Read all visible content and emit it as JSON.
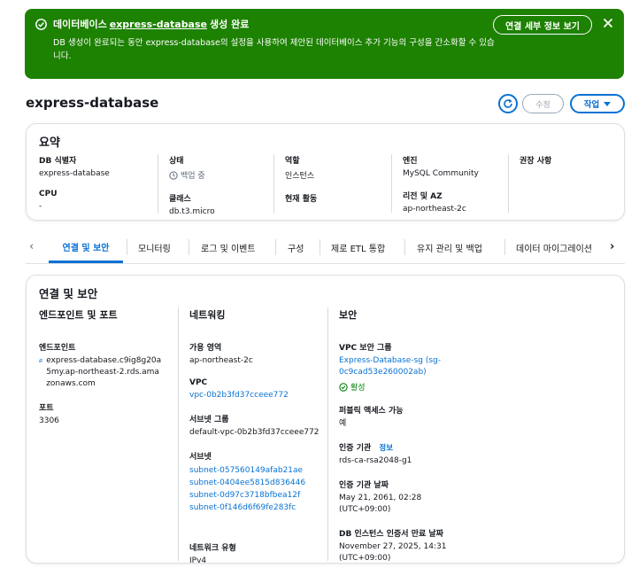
{
  "flash": {
    "title_prefix": "데이터베이스",
    "db_name": "express-database",
    "title_suffix": "생성 완료",
    "message": "DB 생성이 완료되는 동안 express-database의 설정을 사용하여 제안된 데이터베이스 추가 기능의 구성을 간소화할 수 있습니다.",
    "detail_button": "연결 세부 정보 보기",
    "color": "#1d8102"
  },
  "header": {
    "title": "express-database",
    "edit_button": "수정",
    "action_button": "작업"
  },
  "summary": {
    "title": "요약",
    "fields": {
      "db_id_label": "DB 식별자",
      "db_id_value": "express-database",
      "cpu_label": "CPU",
      "cpu_value": "-",
      "status_label": "상태",
      "status_value": "백업 중",
      "class_label": "클래스",
      "class_value": "db.t3.micro",
      "role_label": "역할",
      "role_value": "인스턴스",
      "activity_label": "현재 활동",
      "engine_label": "엔진",
      "engine_value": "MySQL Community",
      "region_label": "리전 및 AZ",
      "region_value": "ap-northeast-2c",
      "recommend_label": "권장 사항"
    }
  },
  "tabs": [
    {
      "label": "연결 및 보안"
    },
    {
      "label": "모니터링"
    },
    {
      "label": "로그 및 이벤트"
    },
    {
      "label": "구성"
    },
    {
      "label": "제로 ETL 통합"
    },
    {
      "label": "유지 관리 및 백업"
    },
    {
      "label": "데이터 마이그레이션"
    }
  ],
  "connectivity": {
    "title": "연결 및 보안",
    "endpoint_section": {
      "heading": "엔드포인트 및 포트",
      "endpoint_label": "엔드포인트",
      "endpoint_value": "express-database.c9ig8g20a5my.ap-northeast-2.rds.amazonaws.com",
      "port_label": "포트",
      "port_value": "3306"
    },
    "network_section": {
      "heading": "네트워킹",
      "az_label": "가용 영역",
      "az_value": "ap-northeast-2c",
      "vpc_label": "VPC",
      "vpc_value": "vpc-0b2b3fd37cceee772",
      "subnet_group_label": "서브넷 그룹",
      "subnet_group_value": "default-vpc-0b2b3fd37cceee772",
      "subnets_label": "서브넷",
      "subnets": [
        "subnet-057560149afab21ae",
        "subnet-0404ee5815d836446",
        "subnet-0d97c3718bfbea12f",
        "subnet-0f146d6f69fe283fc"
      ],
      "network_type_label": "네트워크 유형",
      "network_type_value": "IPv4"
    },
    "security_section": {
      "heading": "보안",
      "sg_label": "VPC 보안 그룹",
      "sg_value": "Express-Database-sg (sg-0c9cad53e260002ab)",
      "sg_status": "활성",
      "public_label": "퍼블릭 액세스 가능",
      "public_value": "예",
      "ca_label": "인증 기관",
      "ca_info": "정보",
      "ca_value": "rds-ca-rsa2048-g1",
      "ca_date_label": "인증 기관 날짜",
      "ca_date_value": "May 21, 2061, 02:28 (UTC+09:00)",
      "cert_expiry_label": "DB 인스턴스 인증서 만료 날짜",
      "cert_expiry_value": "November 27, 2025, 14:31 (UTC+09:00)"
    }
  },
  "colors": {
    "link": "#0972d3",
    "success": "#037f0c",
    "banner": "#1d8102"
  }
}
